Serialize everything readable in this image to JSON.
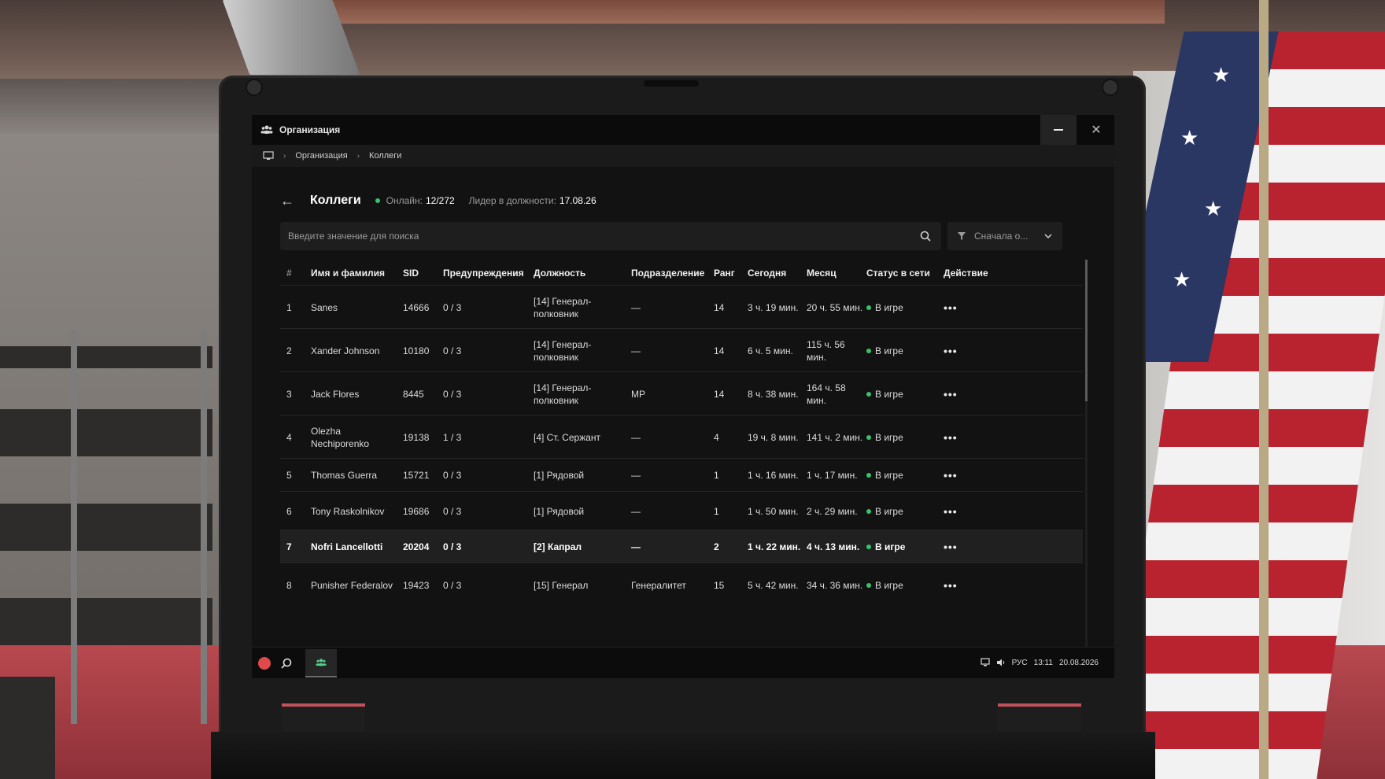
{
  "window": {
    "title": "Организация"
  },
  "breadcrumb": {
    "items": [
      "Организация",
      "Коллеги"
    ]
  },
  "header": {
    "title": "Коллеги",
    "online_label": "Онлайн:",
    "online_value": "12/272",
    "leader_label": "Лидер в должности:",
    "leader_value": "17.08.26"
  },
  "search": {
    "placeholder": "Введите значение для поиска"
  },
  "sort": {
    "label": "Сначала о..."
  },
  "table": {
    "columns": [
      "#",
      "Имя и фамилия",
      "SID",
      "Предупреждения",
      "Должность",
      "Подразделение",
      "Ранг",
      "Сегодня",
      "Месяц",
      "Статус в сети",
      "Действие"
    ],
    "rows": [
      {
        "n": "1",
        "name": "Sanes",
        "sid": "14666",
        "warn": "0 / 3",
        "pos": "[14] Генерал-полковник",
        "dept": "—",
        "rank": "14",
        "today": "3 ч. 19 мин.",
        "month": "20 ч. 55 мин.",
        "status": "В игре"
      },
      {
        "n": "2",
        "name": "Xander Johnson",
        "sid": "10180",
        "warn": "0 / 3",
        "pos": "[14] Генерал-полковник",
        "dept": "—",
        "rank": "14",
        "today": "6 ч. 5 мин.",
        "month": "115 ч. 56 мин.",
        "status": "В игре"
      },
      {
        "n": "3",
        "name": "Jack Flores",
        "sid": "8445",
        "warn": "0 / 3",
        "pos": "[14] Генерал-полковник",
        "dept": "MP",
        "rank": "14",
        "today": "8 ч. 38 мин.",
        "month": "164 ч. 58 мин.",
        "status": "В игре"
      },
      {
        "n": "4",
        "name": "Olezha Nechiporenko",
        "sid": "19138",
        "warn": "1 / 3",
        "pos": "[4] Ст. Сержант",
        "dept": "—",
        "rank": "4",
        "today": "19 ч. 8 мин.",
        "month": "141 ч. 2 мин.",
        "status": "В игре"
      },
      {
        "n": "5",
        "name": "Thomas Guerra",
        "sid": "15721",
        "warn": "0 / 3",
        "pos": "[1] Рядовой",
        "dept": "—",
        "rank": "1",
        "today": "1 ч. 16 мин.",
        "month": "1 ч. 17 мин.",
        "status": "В игре"
      },
      {
        "n": "6",
        "name": "Tony Raskolnikov",
        "sid": "19686",
        "warn": "0 / 3",
        "pos": "[1] Рядовой",
        "dept": "—",
        "rank": "1",
        "today": "1 ч. 50 мин.",
        "month": "2 ч. 29 мин.",
        "status": "В игре"
      },
      {
        "n": "7",
        "name": "Nofri Lancellotti",
        "sid": "20204",
        "warn": "0 / 3",
        "pos": "[2] Капрал",
        "dept": "—",
        "rank": "2",
        "today": "1 ч. 22 мин.",
        "month": "4 ч. 13 мин.",
        "status": "В игре"
      },
      {
        "n": "8",
        "name": "Punisher Federalov",
        "sid": "19423",
        "warn": "0 / 3",
        "pos": "[15] Генерал",
        "dept": "Генералитет",
        "rank": "15",
        "today": "5 ч. 42 мин.",
        "month": "34 ч. 36 мин.",
        "status": "В игре"
      }
    ]
  },
  "taskbar": {
    "lang": "РУС",
    "time": "13:11",
    "date": "20.08.2026"
  },
  "colors": {
    "online": "#35c46a",
    "accent_red": "#e14a4a"
  }
}
